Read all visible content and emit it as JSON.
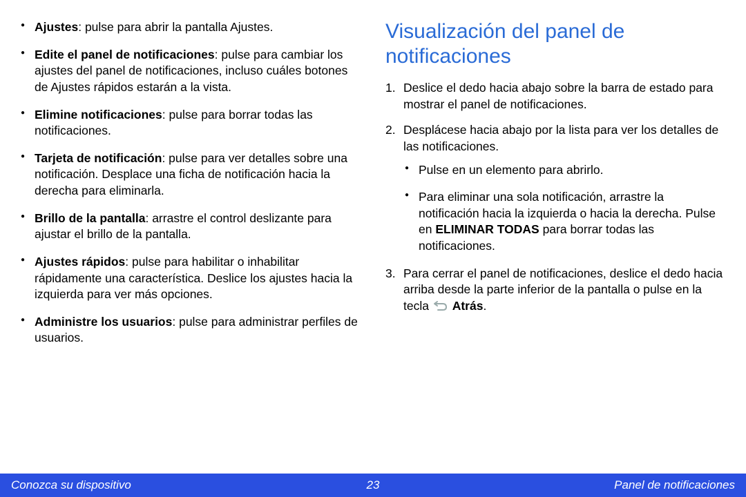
{
  "left": {
    "items": [
      {
        "bold": "Ajustes",
        "text": ": pulse para abrir la pantalla Ajustes."
      },
      {
        "bold": "Edite el panel de notificaciones",
        "text": ": pulse para cambiar los ajustes del panel de notificaciones, incluso cuáles botones de Ajustes rápidos estarán a la vista."
      },
      {
        "bold": "Elimine notificaciones",
        "text": ": pulse para borrar todas las notificaciones."
      },
      {
        "bold": "Tarjeta de notificación",
        "text": ": pulse para ver detalles sobre una notificación. Desplace una ficha de notificación hacia la derecha para eliminarla."
      },
      {
        "bold": "Brillo de la pantalla",
        "text": ": arrastre el control deslizante para ajustar el brillo de la pantalla."
      },
      {
        "bold": "Ajustes rápidos",
        "text": ": pulse para habilitar o inhabilitar rápidamente una característica. Deslice los ajustes hacia la izquierda para ver más opciones."
      },
      {
        "bold": "Administre los usuarios",
        "text": ": pulse para administrar perfiles de usuarios."
      }
    ]
  },
  "right": {
    "heading": "Visualización del panel de notificaciones",
    "steps": [
      {
        "text": "Deslice el dedo hacia abajo sobre la barra de estado para mostrar el panel de notificaciones."
      },
      {
        "text": "Desplácese hacia abajo por la lista para ver los detalles de las notificaciones.",
        "sub": [
          "Pulse en un elemento para abrirlo.",
          {
            "pre": "Para eliminar una sola notificación, arrastre la notificación hacia la izquierda o hacia la derecha. Pulse en ",
            "strong": "ELIMINAR TODAS",
            "post": " para borrar todas las notificaciones."
          }
        ]
      },
      {
        "pre": "Para cerrar el panel de notificaciones, deslice el dedo hacia arriba desde la parte inferior de la pantalla o pulse en la tecla ",
        "icon": "back",
        "strong": "Atrás",
        "post": "."
      }
    ]
  },
  "footer": {
    "left": "Conozca su dispositivo",
    "center": "23",
    "right": "Panel de notificaciones"
  }
}
